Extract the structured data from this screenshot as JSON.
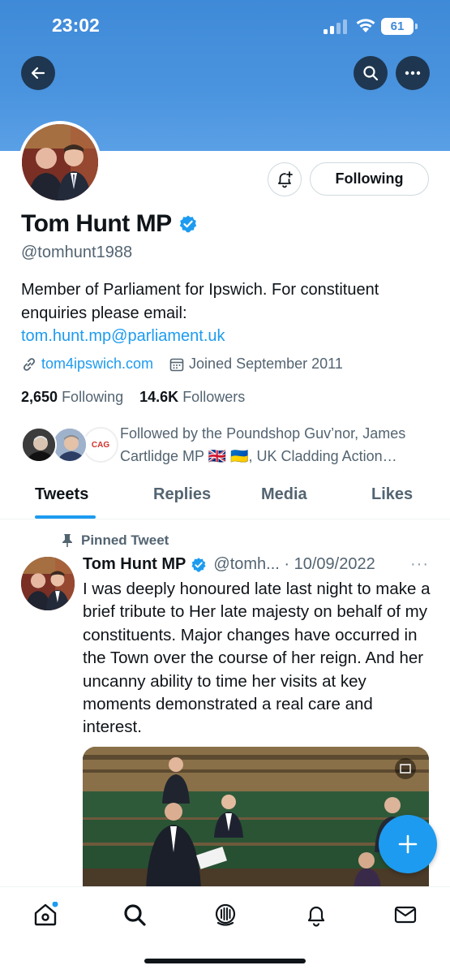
{
  "status_bar": {
    "time": "23:02",
    "battery": "61"
  },
  "profile": {
    "name": "Tom Hunt MP",
    "handle": "@tomhunt1988",
    "bio_text": "Member of Parliament for Ipswich. For constituent enquiries please email:",
    "bio_email": "tom.hunt.mp@parliament.uk",
    "website": "tom4ipswich.com",
    "joined": "Joined September 2011",
    "following_count": "2,650",
    "following_label": "Following",
    "followers_count": "14.6K",
    "followers_label": "Followers",
    "followed_by": "Followed by the Poundshop Guv’nor, James Cartlidge MP 🇬🇧 🇺🇦, UK Cladding Action…",
    "follow_button": "Following",
    "mini_avatar_3_text": "CAG"
  },
  "tabs": [
    "Tweets",
    "Replies",
    "Media",
    "Likes"
  ],
  "tweet": {
    "pinned_label": "Pinned Tweet",
    "author": "Tom Hunt MP",
    "handle_date": "@tomh... · 10/09/2022",
    "more": "···",
    "text": "I was deeply honoured late last night to make a brief tribute to Her late majesty on behalf of my constituents. Major changes have occurred in the Town over the course of her reign. And her uncanny ability to time her visits at key moments demonstrated a real care and interest."
  },
  "icons": {
    "back": "arrow-left-icon",
    "search": "search-icon",
    "more": "more-icon",
    "notify": "bell-plus-icon",
    "verified": "verified-badge-icon",
    "link": "link-icon",
    "calendar": "calendar-icon",
    "pin": "pin-icon",
    "compose": "plus-icon",
    "nav": [
      "home-icon",
      "search-icon",
      "spaces-icon",
      "bell-icon",
      "mail-icon"
    ]
  },
  "colors": {
    "accent": "#1d9bf0",
    "banner": "#4a93de",
    "text": "#0f1419",
    "muted": "#536471"
  }
}
